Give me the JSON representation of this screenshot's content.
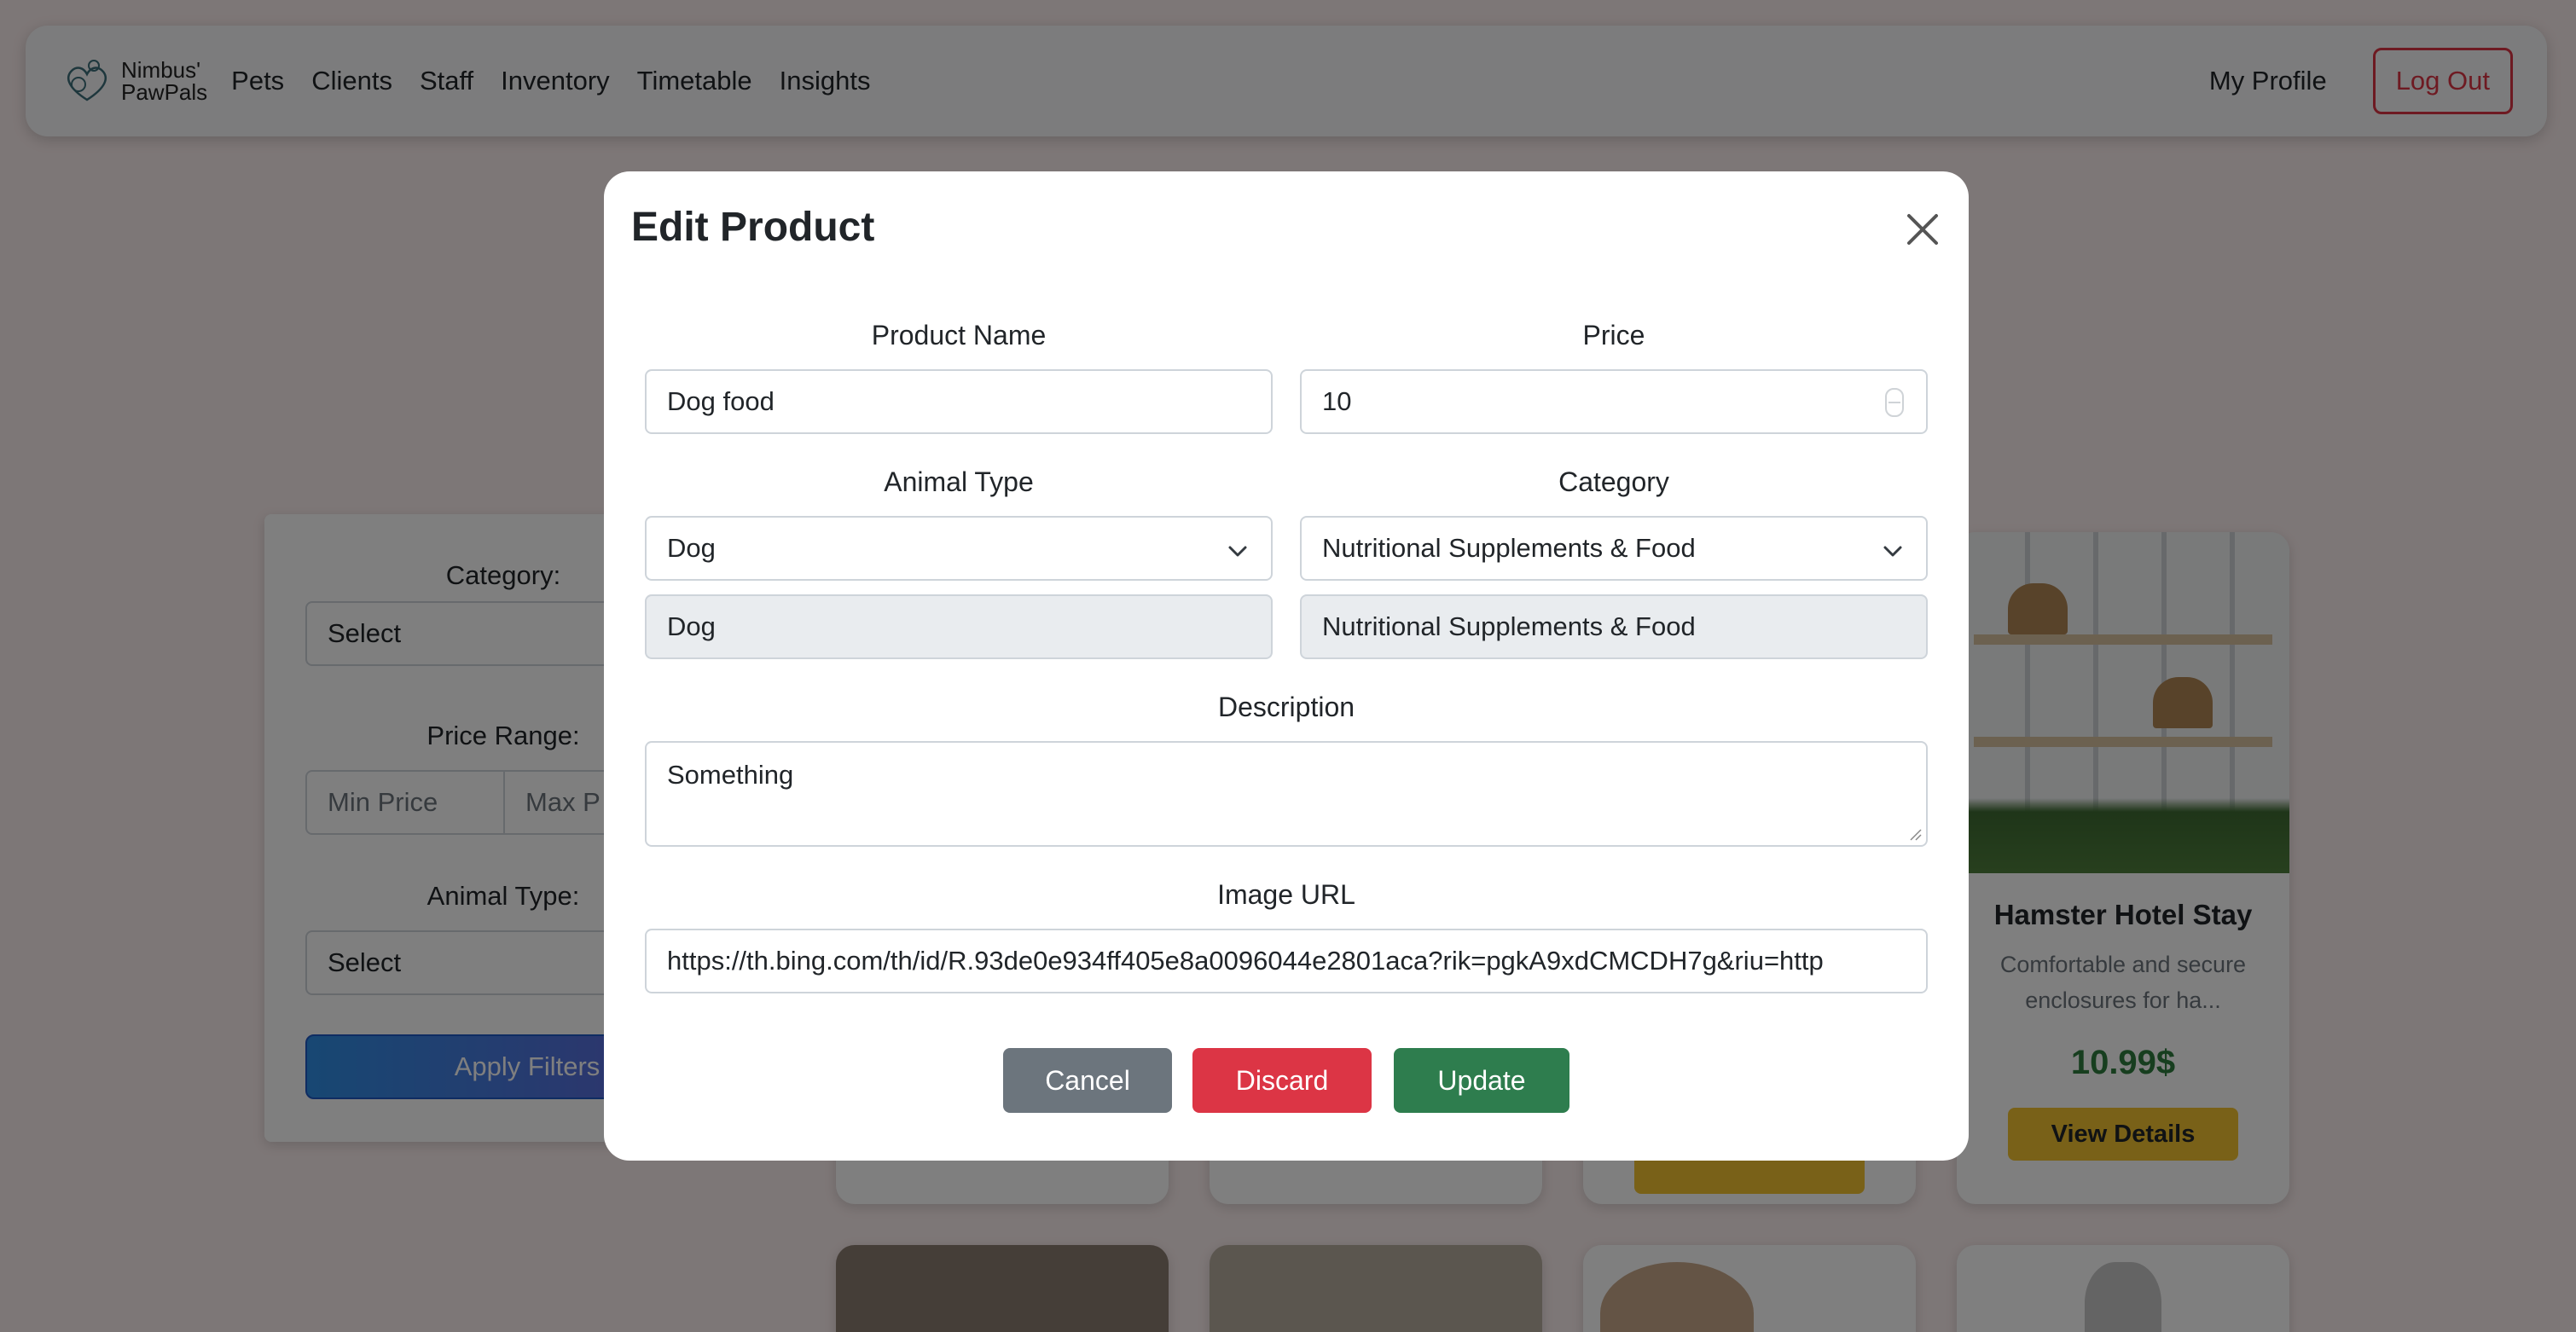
{
  "navbar": {
    "brand_line1": "Nimbus'",
    "brand_line2": "PawPals",
    "links": [
      "Pets",
      "Clients",
      "Staff",
      "Inventory",
      "Timetable",
      "Insights"
    ],
    "profile_label": "My Profile",
    "logout_label": "Log Out"
  },
  "filters": {
    "category_label": "Category:",
    "category_value": "Select",
    "price_label": "Price Range:",
    "min_price_placeholder": "Min Price",
    "max_price_placeholder": "Max P",
    "animal_label": "Animal Type:",
    "animal_value": "Select",
    "apply_label": "Apply Filters"
  },
  "card": {
    "title": "Hamster Hotel Stay",
    "description_line1": "Comfortable and secure",
    "description_line2": "enclosures for ha...",
    "price": "10.99$",
    "view_label": "View Details"
  },
  "modal": {
    "title": "Edit Product",
    "product_name_label": "Product Name",
    "product_name_value": "Dog food",
    "price_label": "Price",
    "price_value": "10",
    "animal_type_label": "Animal Type",
    "animal_type_value": "Dog",
    "animal_type_readonly": "Dog",
    "category_label": "Category",
    "category_value": "Nutritional Supplements & Food",
    "category_readonly": "Nutritional Supplements & Food",
    "description_label": "Description",
    "description_value": "Something",
    "image_url_label": "Image URL",
    "image_url_value": "https://th.bing.com/th/id/R.93de0e934ff405e8a0096044e2801aca?rik=pgkA9xdCMCDH7g&riu=http",
    "cancel_label": "Cancel",
    "discard_label": "Discard",
    "update_label": "Update"
  },
  "colors": {
    "danger": "#dc3545",
    "success": "#2e7d4e",
    "secondary": "#6c757d",
    "warning": "#f2c230",
    "price_green": "#2e7d3e"
  }
}
